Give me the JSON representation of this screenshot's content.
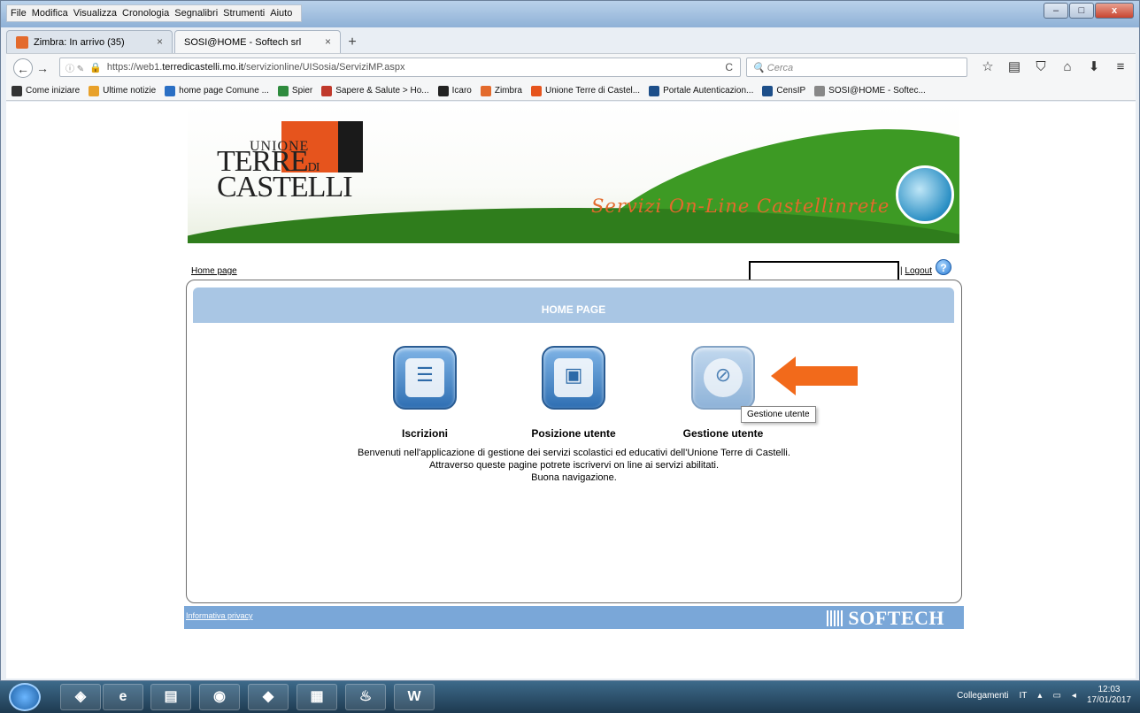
{
  "menu": [
    "File",
    "Modifica",
    "Visualizza",
    "Cronologia",
    "Segnalibri",
    "Strumenti",
    "Aiuto"
  ],
  "window_buttons": {
    "minimize": "–",
    "maximize": "□",
    "close": "x"
  },
  "tabs": [
    {
      "label": "Zimbra: In arrivo (35)",
      "active": false
    },
    {
      "label": "SOSI@HOME - Softech srl",
      "active": true
    }
  ],
  "tab_close_glyph": "×",
  "newtab_glyph": "+",
  "nav": {
    "url_prefix": "https://web1.",
    "url_domain": "terredicastelli.mo.it",
    "url_path": "/servizionline/UISosia/ServiziMP.aspx",
    "search_placeholder": "Cerca",
    "back_glyph": "←",
    "forward_glyph": "→",
    "reload_glyph": "C",
    "site_info_glyphs": "ⓘ ✎",
    "lock_glyph": "🔒",
    "search_glyph": "🔍"
  },
  "toolbar_icons": [
    "☆",
    "▤",
    "⛉",
    "⌂",
    "⬇",
    "≡"
  ],
  "bookmarks": [
    {
      "label": "Come iniziare",
      "color": "#333333"
    },
    {
      "label": "Ultime notizie",
      "color": "#e8a12a"
    },
    {
      "label": "home page Comune ...",
      "color": "#2a6fc4"
    },
    {
      "label": "Spier",
      "color": "#2e8b3e"
    },
    {
      "label": "Sapere & Salute > Ho...",
      "color": "#c0392b"
    },
    {
      "label": "Icaro",
      "color": "#222222"
    },
    {
      "label": "Zimbra",
      "color": "#e36a2c"
    },
    {
      "label": "Unione Terre di Castel...",
      "color": "#e6541d"
    },
    {
      "label": "Portale Autenticazion...",
      "color": "#1d4f8a"
    },
    {
      "label": "CensIP",
      "color": "#1d4f8a"
    },
    {
      "label": "SOSI@HOME - Softec...",
      "color": "#888888"
    }
  ],
  "banner": {
    "logo_line1": "UNIONE",
    "logo_line2": "TERRE",
    "logo_di": "DI",
    "logo_line3": "CASTELLI",
    "tagline": "Servizi On-Line Castellinrete"
  },
  "header": {
    "breadcrumb": "Home page",
    "logout_separator": "|",
    "logout": "Logout",
    "help": "?"
  },
  "panel": {
    "title": "HOME PAGE",
    "actions": [
      {
        "label": "Iscrizioni",
        "icon": "enrollment-icon",
        "glyph": "☰",
        "enabled": true
      },
      {
        "label": "Posizione utente",
        "icon": "user-position-icon",
        "glyph": "▣",
        "enabled": true
      },
      {
        "label": "Gestione utente",
        "icon": "user-management-icon",
        "glyph": "⊘",
        "enabled": false
      }
    ],
    "tooltip": "Gestione utente",
    "welcome": [
      "Benvenuti nell'applicazione di gestione dei servizi scolastici ed educativi dell'Unione Terre di Castelli.",
      "Attraverso queste pagine potrete iscrivervi on line ai servizi abilitati.",
      "Buona navigazione."
    ]
  },
  "footer": {
    "privacy": "Informativa privacy",
    "brand": "SOFTECH"
  },
  "taskbar": {
    "apps": [
      {
        "icon": "outlook-icon",
        "glyph": "◈"
      },
      {
        "icon": "internet-explorer-icon",
        "glyph": "e"
      },
      {
        "icon": "file-explorer-icon",
        "glyph": "▤"
      },
      {
        "icon": "firefox-icon",
        "glyph": "◉"
      },
      {
        "icon": "app-icon",
        "glyph": "◆"
      },
      {
        "icon": "network-icon",
        "glyph": "▦"
      },
      {
        "icon": "java-icon",
        "glyph": "♨"
      },
      {
        "icon": "word-icon",
        "glyph": "W"
      }
    ],
    "links_label": "Collegamenti",
    "language": "IT",
    "tray_glyphs": [
      "▴",
      "▭",
      "◂"
    ],
    "time": "12:03",
    "date": "17/01/2017"
  },
  "colors": {
    "panel_header": "#a9c6e4",
    "footer_bar": "#7aa7d8",
    "arrow": "#f26a1b",
    "tagline": "#e36a2c"
  }
}
